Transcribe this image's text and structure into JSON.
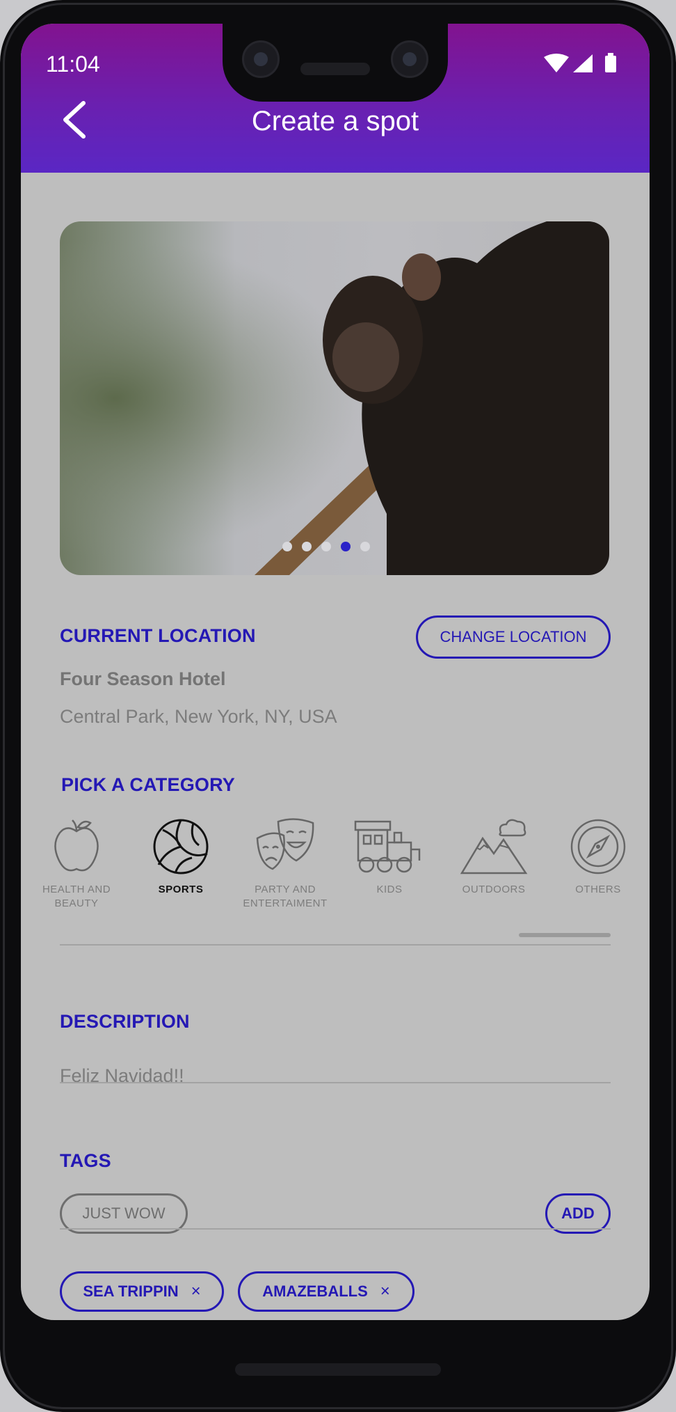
{
  "status_bar": {
    "time": "11:04"
  },
  "header": {
    "title": "Create a spot"
  },
  "carousel": {
    "slide_count": 5,
    "active_index": 3
  },
  "location": {
    "section_label": "CURRENT LOCATION",
    "change_button": "CHANGE LOCATION",
    "place_name": "Four Season Hotel",
    "address": "Central Park, New York, NY, USA"
  },
  "category": {
    "section_label": "PICK A CATEGORY",
    "items": [
      {
        "label": "HEALTH AND BEAUTY",
        "icon": "apple-icon",
        "selected": false
      },
      {
        "label": "SPORTS",
        "icon": "volleyball-icon",
        "selected": true
      },
      {
        "label": "PARTY AND ENTERTAIMENT",
        "icon": "theater-masks-icon",
        "selected": false
      },
      {
        "label": "KIDS",
        "icon": "toy-train-icon",
        "selected": false
      },
      {
        "label": "OUTDOORS",
        "icon": "mountains-icon",
        "selected": false
      },
      {
        "label": "OTHERS",
        "icon": "compass-icon",
        "selected": false
      }
    ]
  },
  "description": {
    "section_label": "DESCRIPTION",
    "value": "Feliz Navidad!!"
  },
  "tags": {
    "section_label": "TAGS",
    "input_value": "JUST WOW",
    "add_button": "ADD",
    "items": [
      "SEA TRIPPIN",
      "AMAZEBALLS"
    ],
    "remove_glyph": "×"
  },
  "colors": {
    "accent": "#2418b4",
    "header_top": "#82138f",
    "header_bottom": "#5a27c4"
  }
}
